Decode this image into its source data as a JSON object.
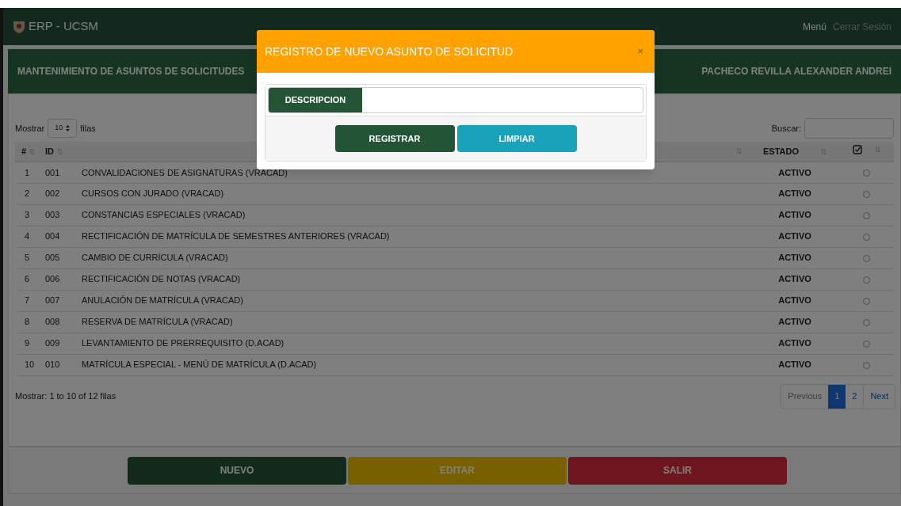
{
  "navbar": {
    "brand": "ERP - UCSM",
    "links": [
      {
        "label": "Menú",
        "kind": "primary"
      },
      {
        "label": "Cerrar Sesión",
        "kind": "muted"
      }
    ]
  },
  "panel": {
    "title": "MANTENIMIENTO DE ASUNTOS DE SOLICITUDES",
    "user": "PACHECO REVILLA ALEXANDER ANDREI"
  },
  "controls": {
    "show_label": "Mostrar",
    "page_size": "10",
    "rows_label": "filas",
    "search_label": "Buscar:"
  },
  "table": {
    "columns": [
      {
        "label": "#",
        "kind": "number"
      },
      {
        "label": "ID",
        "kind": "id"
      },
      {
        "kind": "description"
      },
      {
        "label": "ESTADO",
        "kind": "status"
      },
      {
        "kind": "check"
      }
    ],
    "rows": [
      {
        "n": "1",
        "id": "001",
        "description": "CONVALIDACIONES DE ASIGNATURAS (VRACAD)",
        "estado": "ACTIVO",
        "selected": false
      },
      {
        "n": "2",
        "id": "002",
        "description": "CURSOS CON JURADO (VRACAD)",
        "estado": "ACTIVO",
        "selected": false
      },
      {
        "n": "3",
        "id": "003",
        "description": "CONSTANCIAS ESPECIALES (VRACAD)",
        "estado": "ACTIVO",
        "selected": false
      },
      {
        "n": "4",
        "id": "004",
        "description": "RECTIFICACIÓN DE MATRÍCULA DE SEMESTRES ANTERIORES (VRACAD)",
        "estado": "ACTIVO",
        "selected": false
      },
      {
        "n": "5",
        "id": "005",
        "description": "CAMBIO DE CURRÍCULA (VRACAD)",
        "estado": "ACTIVO",
        "selected": false
      },
      {
        "n": "6",
        "id": "006",
        "description": "RECTIFICACIÓN DE NOTAS (VRACAD)",
        "estado": "ACTIVO",
        "selected": false
      },
      {
        "n": "7",
        "id": "007",
        "description": "ANULACIÓN DE MATRÍCULA (VRACAD)",
        "estado": "ACTIVO",
        "selected": false
      },
      {
        "n": "8",
        "id": "008",
        "description": "RESERVA DE MATRÍCULA (VRACAD)",
        "estado": "ACTIVO",
        "selected": false
      },
      {
        "n": "9",
        "id": "009",
        "description": "LEVANTAMIENTO DE PRERREQUISITO (D.ACAD)",
        "estado": "ACTIVO",
        "selected": false
      },
      {
        "n": "10",
        "id": "010",
        "description": "MATRÍCULA ESPECIAL - MENÚ DE MATRÍCULA (D.ACAD)",
        "estado": "ACTIVO",
        "selected": false
      }
    ]
  },
  "info": "Mostrar: 1 to 10 of 12 filas",
  "pagination": {
    "previous": "Previous",
    "pages": [
      {
        "label": "1",
        "selected": true
      },
      {
        "label": "2",
        "selected": false
      }
    ],
    "next": "Next"
  },
  "actions": [
    {
      "label": "NUEVO",
      "kind": "primary"
    },
    {
      "label": "EDITAR",
      "kind": "warning"
    },
    {
      "label": "SALIR",
      "kind": "danger"
    }
  ],
  "modal": {
    "title": "REGISTRO DE NUEVO ASUNTO DE SOLICITUD",
    "close": "×",
    "field_label": "DESCRIPCION",
    "buttons": [
      {
        "label": "REGISTRAR",
        "kind": "primary"
      },
      {
        "label": "LIMPIAR",
        "kind": "info"
      }
    ]
  }
}
